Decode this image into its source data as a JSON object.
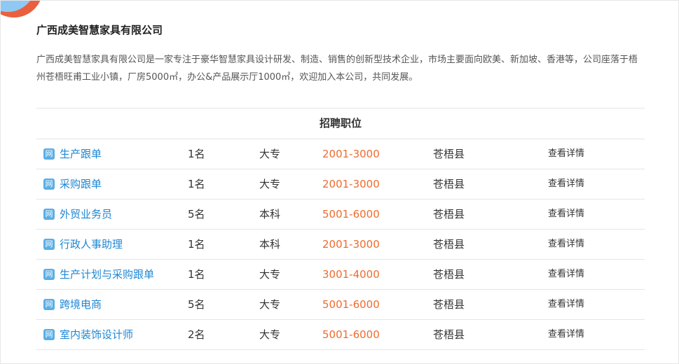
{
  "company": {
    "name": "广西成美智慧家具有限公司",
    "intro": "广西成美智慧家具有限公司是一家专注于豪华智慧家具设计研发、制造、销售的创新型技术企业，市场主要面向欧美、新加坡、香港等，公司座落于梧州苍梧旺甫工业小镇，厂房5000㎡，办公&产品展示厅1000㎡，欢迎加入本公司，共同发展。"
  },
  "jobs": {
    "title": "招聘职位",
    "icon_text": "网",
    "detail_label": "查看详情",
    "rows": [
      {
        "title": "生产跟单",
        "count": "1名",
        "education": "大专",
        "salary": "2001-3000",
        "location": "苍梧县"
      },
      {
        "title": "采购跟单",
        "count": "1名",
        "education": "大专",
        "salary": "2001-3000",
        "location": "苍梧县"
      },
      {
        "title": "外贸业务员",
        "count": "5名",
        "education": "本科",
        "salary": "5001-6000",
        "location": "苍梧县"
      },
      {
        "title": "行政人事助理",
        "count": "1名",
        "education": "本科",
        "salary": "2001-3000",
        "location": "苍梧县"
      },
      {
        "title": "生产计划与采购跟单",
        "count": "1名",
        "education": "大专",
        "salary": "3001-4000",
        "location": "苍梧县"
      },
      {
        "title": "跨境电商",
        "count": "5名",
        "education": "大专",
        "salary": "5001-6000",
        "location": "苍梧县"
      },
      {
        "title": "室内装饰设计师",
        "count": "2名",
        "education": "大专",
        "salary": "5001-6000",
        "location": "苍梧县"
      }
    ]
  },
  "colors": {
    "link": "#1e87d4",
    "salary": "#ef6b2d",
    "icon_bg": "#5aaee6",
    "accent_orange": "#e9603f",
    "accent_blue": "#8ec9f4"
  }
}
